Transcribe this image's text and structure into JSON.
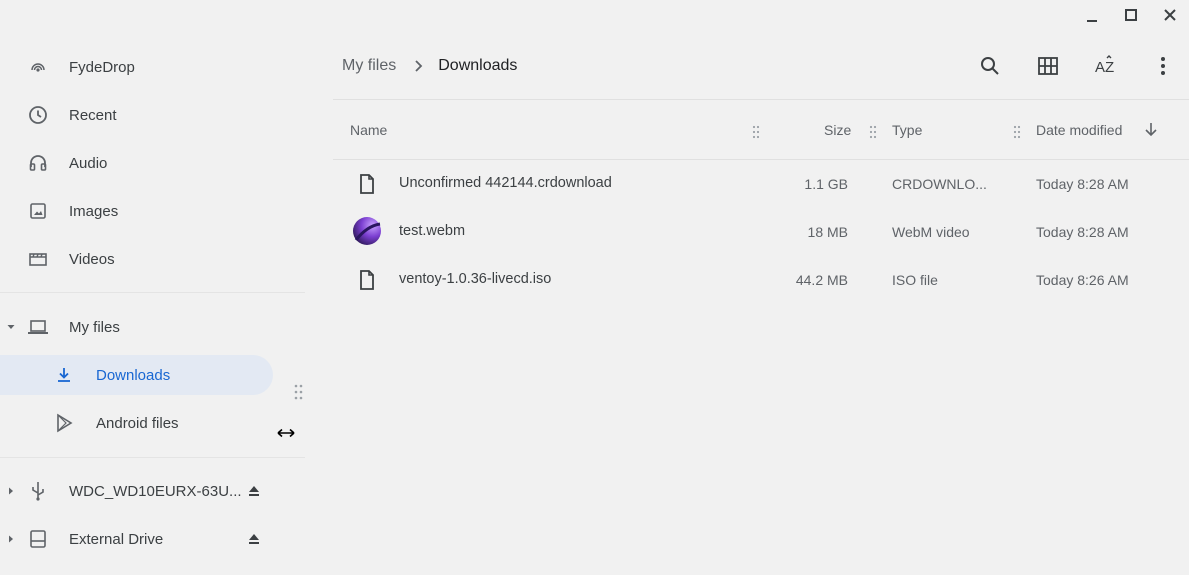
{
  "window": {
    "minimize_icon": "minimize-icon",
    "maximize_icon": "maximize-icon",
    "close_icon": "close-icon"
  },
  "sidebar": {
    "items": [
      {
        "label": "FydeDrop",
        "icon": "fydedrop-icon"
      },
      {
        "label": "Recent",
        "icon": "clock-icon"
      },
      {
        "label": "Audio",
        "icon": "headphones-icon"
      },
      {
        "label": "Images",
        "icon": "image-icon"
      },
      {
        "label": "Videos",
        "icon": "film-icon"
      },
      {
        "label": "My files",
        "icon": "laptop-icon",
        "expanded": true
      },
      {
        "label": "Downloads",
        "icon": "download-icon",
        "selected": true
      },
      {
        "label": "Android files",
        "icon": "play-store-icon"
      },
      {
        "label": "WDC_WD10EURX-63U...",
        "icon": "usb-icon",
        "ejectable": true
      },
      {
        "label": "External Drive",
        "icon": "drive-icon",
        "ejectable": true
      }
    ]
  },
  "breadcrumb": {
    "root": "My files",
    "current": "Downloads"
  },
  "toolbar": {
    "search_icon": "search-icon",
    "grid_view_icon": "grid-view-icon",
    "sort_icon": "sort-az-icon",
    "more_icon": "more-vert-icon"
  },
  "table": {
    "columns": [
      "Name",
      "Size",
      "Type",
      "Date modified"
    ],
    "sort_column": "Date modified",
    "sort_direction": "descending",
    "rows": [
      {
        "name": "Unconfirmed 442144.crdownload",
        "size": "1.1 GB",
        "type": "CRDOWNLO...",
        "date": "Today 8:28 AM",
        "icon": "file-icon"
      },
      {
        "name": "test.webm",
        "size": "18 MB",
        "type": "WebM video",
        "date": "Today 8:28 AM",
        "icon": "video-thumbnail-icon"
      },
      {
        "name": "ventoy-1.0.36-livecd.iso",
        "size": "44.2 MB",
        "type": "ISO file",
        "date": "Today 8:26 AM",
        "icon": "file-icon"
      }
    ]
  },
  "colors": {
    "background": "#f1f1f1",
    "selected_bg": "#e3e9f3",
    "accent": "#1967d2",
    "text": "#3c4043",
    "secondary_text": "#5f6368"
  }
}
